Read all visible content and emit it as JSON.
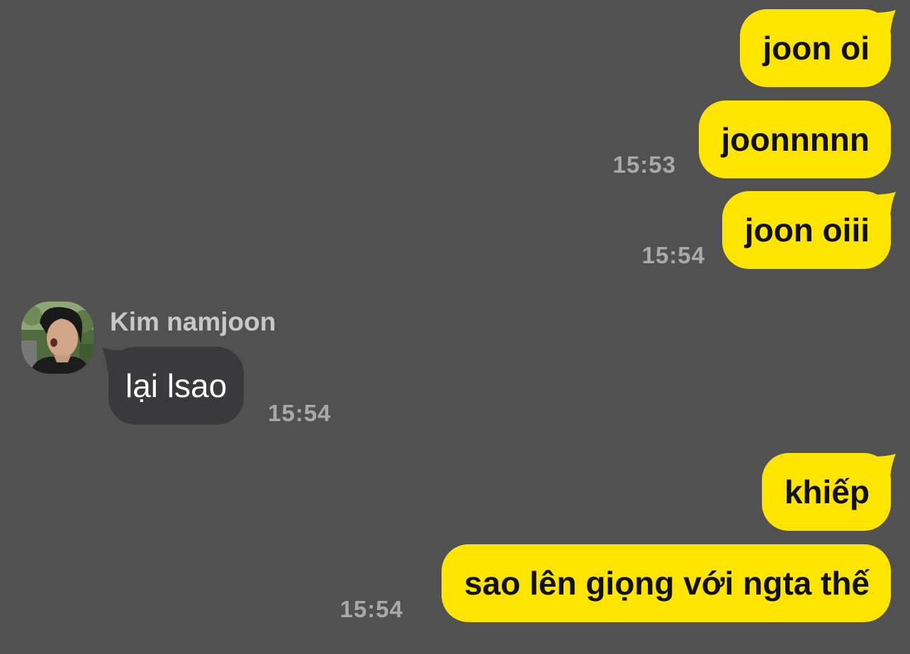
{
  "chat": {
    "messages": [
      {
        "from": "me",
        "text": "joon oi"
      },
      {
        "from": "me",
        "text": "joonnnnn",
        "time": "15:53"
      },
      {
        "from": "me",
        "text": "joon oiii",
        "time": "15:54"
      },
      {
        "from": "other",
        "sender": "Kim namjoon",
        "text": "lại lsao",
        "time": "15:54"
      },
      {
        "from": "me",
        "text": "khiếp"
      },
      {
        "from": "me",
        "text": "sao lên giọng với ngta thế",
        "time": "15:54"
      }
    ]
  },
  "colors": {
    "background": "#525152",
    "my_bubble": "#FEE500",
    "their_bubble": "#3A393B",
    "timestamp": "#A9A8AA",
    "sender_name": "#C8C7C9"
  },
  "icons": {
    "avatar": "profile-photo"
  }
}
